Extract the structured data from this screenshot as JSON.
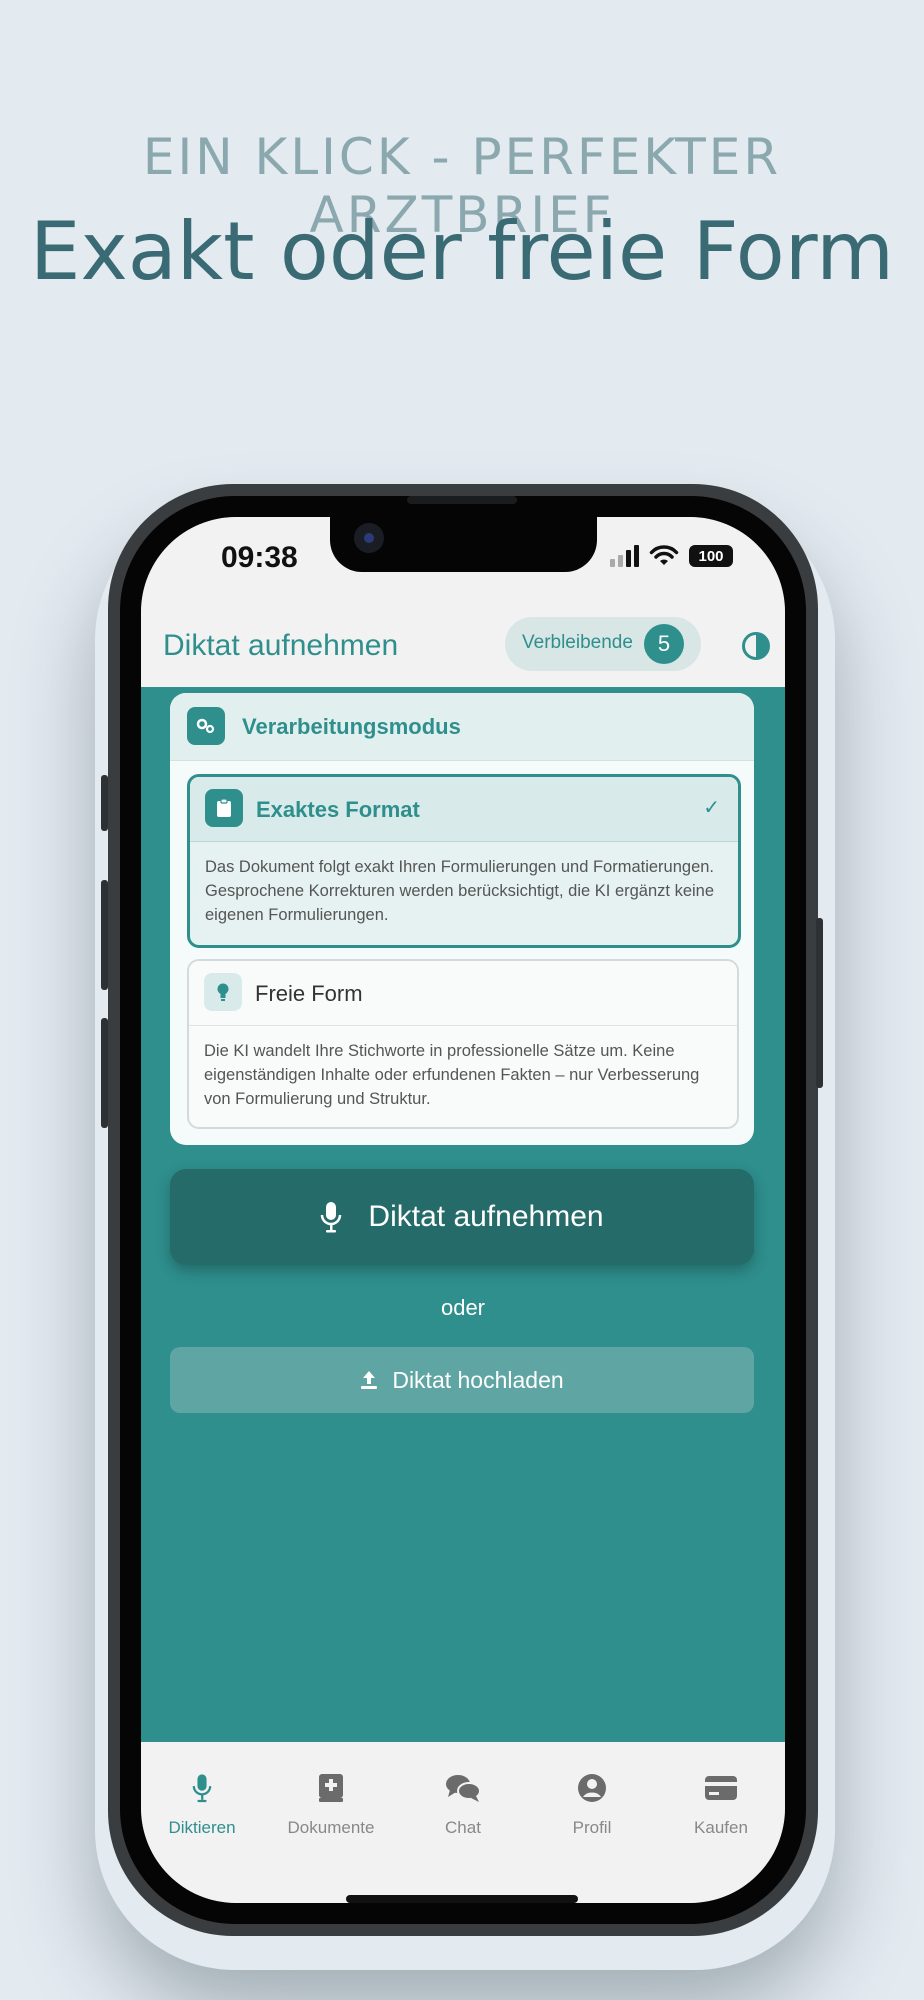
{
  "promo": {
    "subtitle": "EIN KLICK - PERFEKTER ARZTBRIEF",
    "title": "Exakt oder freie Form"
  },
  "status_bar": {
    "time": "09:38",
    "battery": "100"
  },
  "header": {
    "title": "Diktat aufnehmen",
    "remaining_label": "Verbleibende",
    "remaining_count": "5"
  },
  "mode_card": {
    "title": "Verarbeitungsmodus",
    "options": [
      {
        "title": "Exaktes Format",
        "description": "Das Dokument folgt exakt Ihren Formulierungen und Formatierungen. Gesprochene Korrekturen werden berücksichtigt, die KI ergänzt keine eigenen Formulierungen.",
        "selected": true,
        "icon": "clipboard-icon"
      },
      {
        "title": "Freie Form",
        "description": "Die KI wandelt Ihre Stichworte in professionelle Sätze um. Keine eigenständigen Inhalte oder erfundenen Fakten – nur Verbesserung von Formulierung und Struktur.",
        "selected": false,
        "icon": "lightbulb-icon"
      }
    ]
  },
  "record_button_label": "Diktat aufnehmen",
  "or_label": "oder",
  "upload_button_label": "Diktat hochladen",
  "tabs": [
    {
      "label": "Diktieren",
      "icon": "microphone-icon",
      "active": true
    },
    {
      "label": "Dokumente",
      "icon": "medical-book-icon",
      "active": false
    },
    {
      "label": "Chat",
      "icon": "chat-bubbles-icon",
      "active": false
    },
    {
      "label": "Profil",
      "icon": "user-circle-icon",
      "active": false
    },
    {
      "label": "Kaufen",
      "icon": "credit-card-icon",
      "active": false
    }
  ],
  "colors": {
    "accent": "#2e8f8d",
    "background": "#e3eaf0",
    "record_button": "#256b6a"
  }
}
